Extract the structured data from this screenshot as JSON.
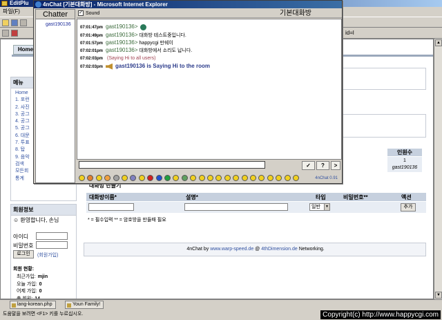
{
  "editplus": {
    "title": "EditPlu",
    "menu_file": "파일(F)",
    "address_text": "id=l"
  },
  "page": {
    "home_tab": "Home",
    "menu_box_title": "메뉴",
    "menu_items": [
      "Home",
      "1. 포런",
      "2. 사진",
      "3. 공그",
      "4. 공그",
      "5. 공그",
      "6. 대문",
      "7. 투표",
      "8. 탑",
      "9. 음악",
      "검색",
      "모든회",
      "통계"
    ],
    "member_box_title": "회원정보",
    "welcome": "환영합니다, 손님",
    "id_label": "아이디",
    "pw_label": "비밀번호",
    "login_button": "로그인",
    "join_link": "(회원가입)",
    "stats_title": "회원 현황:",
    "stats": [
      {
        "label": "최근가입:",
        "value": "mjin"
      },
      {
        "label": "오늘 가입:",
        "value": "0"
      },
      {
        "label": "어제 가입:",
        "value": "0"
      },
      {
        "label": "총 회원:",
        "value": "14"
      }
    ],
    "rooms_header": "인원수",
    "rooms_count": "1",
    "rooms_user": "gast190136",
    "create_title": "대화방 만들기",
    "create_cols": {
      "name": "대화방이름*",
      "desc": "설명*",
      "type": "타입",
      "password": "비밀번호**",
      "action": "액션"
    },
    "type_value": "일반",
    "add_button": "추가",
    "create_note": "* = 필수입력      ** = 암호방을 만들때 필요",
    "footer_prefix": "4nChat by",
    "footer_link1": "www.warp-speed.de",
    "footer_mid": "@",
    "footer_link2": "4thDimension.de",
    "footer_suffix": "Networking."
  },
  "chat_window": {
    "title": "4nChat [기본대화방] - Microsoft Internet Explorer",
    "chatter_header": "Chatter",
    "chatters": [
      "gast190136"
    ],
    "sound_label": "Sound",
    "room_name": "기본대화방",
    "messages": [
      {
        "time": "07:01:47pm",
        "nick": "gast190136>",
        "text": "",
        "avatar": true
      },
      {
        "time": "07:01:49pm",
        "nick": "gast190136>",
        "text": "대화방 테스트중입니다."
      },
      {
        "time": "07:01:57pm",
        "nick": "gast190136>",
        "text": "happycgi 만쉐이"
      },
      {
        "time": "07:02:01pm",
        "nick": "gast190136>",
        "text": "대화방에서 소리도 납니다."
      },
      {
        "time": "07:02:03pm",
        "nick": "",
        "text": "(Saying Hi to all users)",
        "kind": "sys"
      },
      {
        "time": "07:02:03pm",
        "nick": "",
        "text": "gast190136 is Saying Hi to the room",
        "kind": "sys2"
      }
    ],
    "send_button": "✓",
    "help_button": "?",
    "more_button": ">",
    "version": "4nChat 0.91",
    "emoticon_colors": [
      "#f0d020",
      "#e08030",
      "#f0d020",
      "#f0a040",
      "#a0a0a0",
      "#f0d020",
      "#8080c0",
      "#f0d020",
      "#d02020",
      "#2050d0",
      "#20a040",
      "#f0d020",
      "#60a060",
      "#f0d020",
      "#f0d020",
      "#f0d020",
      "#f0d020",
      "#f0d020",
      "#f0d020",
      "#f0d020",
      "#f0d020",
      "#f0d020",
      "#f0d020",
      "#f0d020",
      "#f0d020",
      "#f0d020"
    ]
  },
  "tabs": [
    "lang-korean.php",
    "Youn Family!"
  ],
  "status_text": "도움말을 보려면 <F1> 키를 누르십시오.",
  "copyright": "Copyright(c) http://www.happycgi.com"
}
